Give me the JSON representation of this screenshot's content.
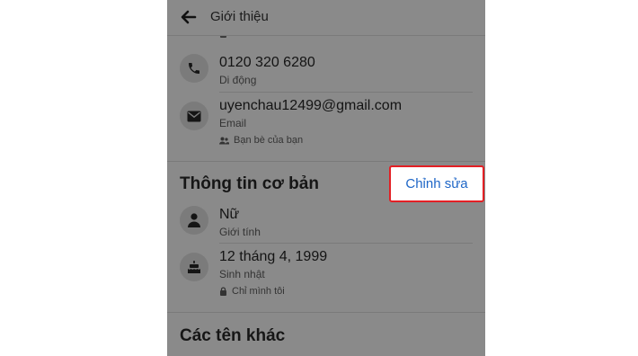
{
  "header": {
    "back_icon": "arrow-left-icon",
    "title": "Giới thiệu"
  },
  "peek_row": {
    "privacy_label": "Chỉ mình tôi",
    "privacy_icon": "lock-icon"
  },
  "contact": {
    "phone": {
      "icon": "phone-icon",
      "value": "0120 320 6280",
      "type": "Di động"
    },
    "email": {
      "icon": "envelope-icon",
      "value": "uyenchau12499@gmail.com",
      "type": "Email",
      "privacy_label": "Bạn bè của bạn",
      "privacy_icon": "friends-icon"
    }
  },
  "basic_info": {
    "title": "Thông tin cơ bản",
    "edit_label": "Chỉnh sửa",
    "gender": {
      "icon": "person-icon",
      "value": "Nữ",
      "label": "Giới tính"
    },
    "birthday": {
      "icon": "cake-icon",
      "value": "12 tháng 4, 1999",
      "label": "Sinh nhật",
      "privacy_label": "Chỉ mình tôi",
      "privacy_icon": "lock-icon"
    }
  },
  "other_names": {
    "title": "Các tên khác"
  },
  "colors": {
    "overlay_gray": "#8a8a8a",
    "highlight_red": "#e32025",
    "link_blue": "#1e66c7"
  }
}
